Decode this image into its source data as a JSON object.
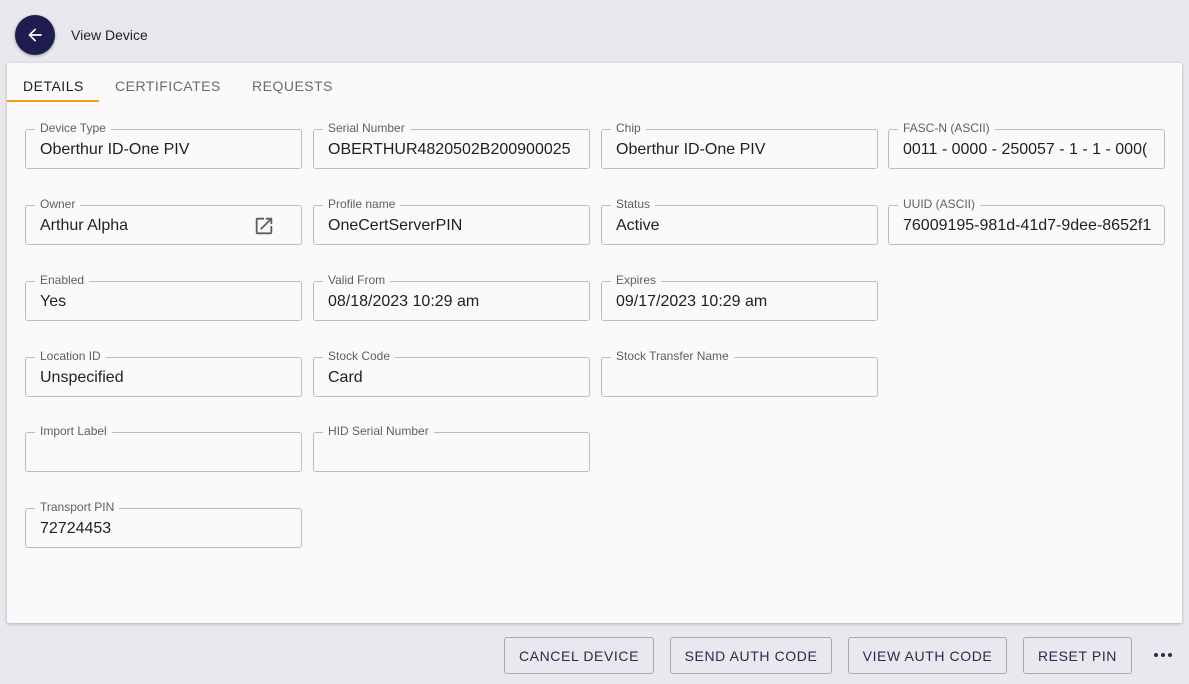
{
  "header": {
    "title": "View Device"
  },
  "tabs": [
    {
      "label": "DETAILS"
    },
    {
      "label": "CERTIFICATES"
    },
    {
      "label": "REQUESTS"
    }
  ],
  "fields": {
    "device_type": {
      "label": "Device Type",
      "value": "Oberthur ID-One PIV"
    },
    "serial_number": {
      "label": "Serial Number",
      "value": "OBERTHUR4820502B200900025"
    },
    "chip": {
      "label": "Chip",
      "value": "Oberthur ID-One PIV"
    },
    "fasc_n": {
      "label": "FASC-N (ASCII)",
      "value": "0011 - 0000 - 250057 - 1 - 1 - 000("
    },
    "owner": {
      "label": "Owner",
      "value": "Arthur Alpha"
    },
    "profile_name": {
      "label": "Profile name",
      "value": "OneCertServerPIN"
    },
    "status": {
      "label": "Status",
      "value": "Active"
    },
    "uuid": {
      "label": "UUID (ASCII)",
      "value": "76009195-981d-41d7-9dee-8652f1"
    },
    "enabled": {
      "label": "Enabled",
      "value": "Yes"
    },
    "valid_from": {
      "label": "Valid From",
      "value": "08/18/2023 10:29 am"
    },
    "expires": {
      "label": "Expires",
      "value": "09/17/2023 10:29 am"
    },
    "location_id": {
      "label": "Location ID",
      "value": "Unspecified"
    },
    "stock_code": {
      "label": "Stock Code",
      "value": "Card"
    },
    "stock_transfer_name": {
      "label": "Stock Transfer Name",
      "value": ""
    },
    "import_label": {
      "label": "Import Label",
      "value": ""
    },
    "hid_serial_number": {
      "label": "HID Serial Number",
      "value": ""
    },
    "transport_pin": {
      "label": "Transport PIN",
      "value": "72724453"
    }
  },
  "footer": {
    "cancel_device": "CANCEL DEVICE",
    "send_auth_code": "SEND AUTH CODE",
    "view_auth_code": "VIEW AUTH CODE",
    "reset_pin": "RESET PIN"
  },
  "icons": {
    "back": "arrow-left-icon",
    "owner_link": "open-in-new-icon",
    "more": "more-horiz-icon"
  },
  "colors": {
    "accent_tab": "#f39c12",
    "back_button": "#1d1d4f"
  }
}
